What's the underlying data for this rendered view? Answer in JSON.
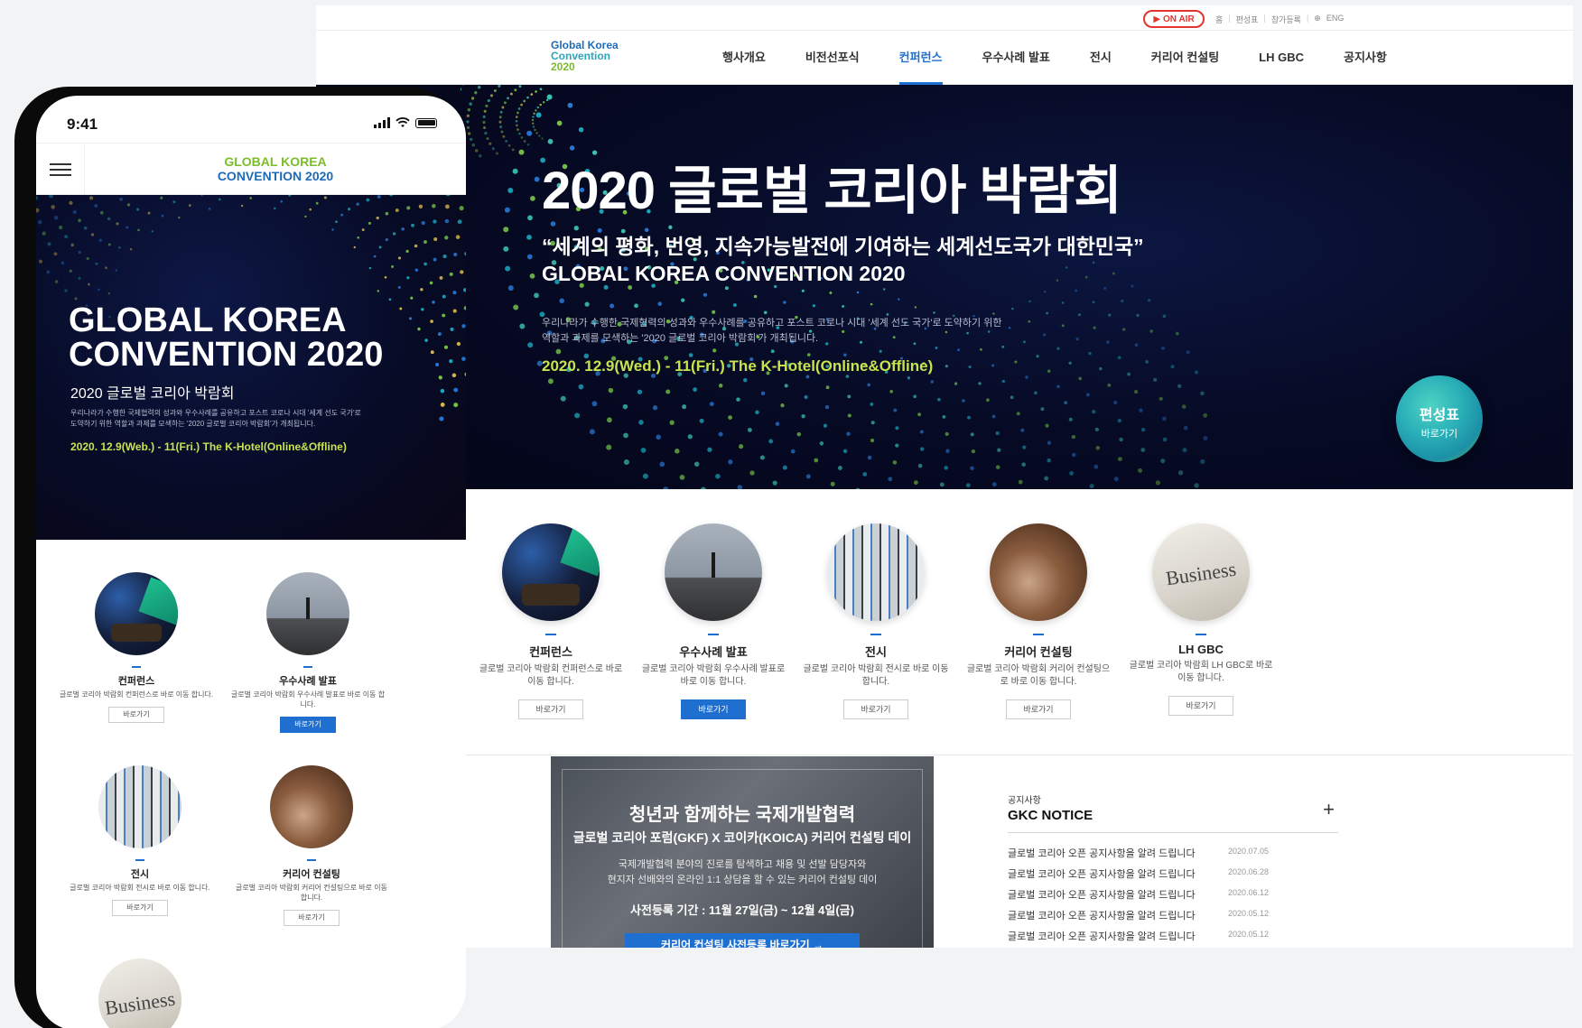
{
  "desktop": {
    "util": {
      "on_air": "ON AIR",
      "links": [
        "홈",
        "편성표",
        "참가등록",
        "ENG"
      ]
    },
    "logo": {
      "line1": "Global Korea",
      "line2": "Convention",
      "line3": "2020"
    },
    "nav": [
      "행사개요",
      "비전선포식",
      "컨퍼런스",
      "우수사례 발표",
      "전시",
      "커리어 컨설팅",
      "LH GBC",
      "공지사항"
    ],
    "nav_active": "컨퍼런스",
    "hero": {
      "title": "2020 글로벌 코리아 박람회",
      "quote": "“세계의 평화, 번영, 지속가능발전에 기여하는 세계선도국가 대한민국”",
      "subtitle_en": "GLOBAL KOREA CONVENTION 2020",
      "description": "우리나라가 수행한 국제협력의 성과와 우수사례를 공유하고 포스트 코로나 시대 '세계 선도 국가'로 도약하기 위한 역할과 과제를 모색하는 '2020 글로벌 코리아 박람회'가 개최됩니다.",
      "date": "2020. 12.9(Wed.) - 11(Fri.)  The K-Hotel(Online&Offline)",
      "badge_title": "편성표",
      "badge_sub": "바로가기"
    },
    "cards": [
      {
        "title": "컨퍼런스",
        "desc": "글로벌 코리아 박람회 컨퍼런스로 바로 이동 합니다.",
        "button": "바로가기",
        "primary": false
      },
      {
        "title": "우수사례 발표",
        "desc": "글로벌 코리아 박람회 우수사례 발표로 바로 이동 합니다.",
        "button": "바로가기",
        "primary": true
      },
      {
        "title": "전시",
        "desc": "글로벌 코리아 박람회 전시로 바로 이동 합니다.",
        "button": "바로가기",
        "primary": false
      },
      {
        "title": "커리어 컨설팅",
        "desc": "글로벌 코리아 박람회 커리어 컨설팅으로 바로 이동 합니다.",
        "button": "바로가기",
        "primary": false
      },
      {
        "title": "LH GBC",
        "desc": "글로벌 코리아 박람회 LH GBC로 바로 이동 합니다.",
        "button": "바로가기",
        "primary": false
      }
    ],
    "promo": {
      "title": "청년과 함께하는 국제개발협력",
      "subtitle": "글로벌 코리아 포럼(GKF) X 코이카(KOICA) 커리어 컨설팅 데이",
      "desc_line1": "국제개발협력 분야의 진로를 탐색하고 채용 및 선발 담당자와",
      "desc_line2": "현지자 선배와의 온라인 1:1 상담을 할 수 있는 커리어 컨설팅 데이",
      "period": "사전등록 기간 : 11월 27일(금) ~ 12월 4일(금)",
      "button": "커리어 컨설팅 사전등록 바로가기 →"
    },
    "notice": {
      "label": "공지사항",
      "title": "GKC NOTICE",
      "more": "+",
      "items": [
        {
          "title": "글로벌 코리아 오픈 공지사항을 알려 드립니다",
          "date": "2020.07.05"
        },
        {
          "title": "글로벌 코리아 오픈 공지사항을 알려 드립니다",
          "date": "2020.06.28"
        },
        {
          "title": "글로벌 코리아 오픈 공지사항을 알려 드립니다",
          "date": "2020.06.12"
        },
        {
          "title": "글로벌 코리아 오픈 공지사항을 알려 드립니다",
          "date": "2020.05.12"
        },
        {
          "title": "글로벌 코리아 오픈 공지사항을 알려 드립니다",
          "date": "2020.05.12"
        }
      ]
    }
  },
  "mobile": {
    "time": "9:41",
    "logo_line1": "GLOBAL KOREA",
    "logo_line2": "CONVENTION 2020",
    "hero": {
      "title_line1": "GLOBAL KOREA",
      "title_line2": "CONVENTION 2020",
      "subtitle": "2020 글로벌 코리아 박람회",
      "description": "우리나라가 수행한 국제협력의 성과와 우수사례를 공유하고 포스트 코로나 시대 '세계 선도 국가'로 도약하기 위한 역할과 과제를 모색하는 '2020 글로벌 코리아 박람회'가 개최됩니다.",
      "date": "2020. 12.9(Web.) - 11(Fri.)  The K-Hotel(Online&Offline)"
    },
    "cards": [
      {
        "title": "컨퍼런스",
        "desc": "글로벌 코리아 박람회 컨퍼런스로 바로 이동 합니다.",
        "button": "바로가기",
        "primary": false
      },
      {
        "title": "우수사례 발표",
        "desc": "글로벌 코리아 박람회 우수사례 발표로 바로 이동 합니다.",
        "button": "바로가기",
        "primary": true
      },
      {
        "title": "전시",
        "desc": "글로벌 코리아 박람회 전시로 바로 이동 합니다.",
        "button": "바로가기",
        "primary": false
      },
      {
        "title": "커리어 컨설팅",
        "desc": "글로벌 코리아 박람회 커리어 컨설팅으로 바로 이동 합니다.",
        "button": "바로가기",
        "primary": false
      }
    ],
    "extra_card_image": "Business"
  },
  "colors": {
    "accent": "#1f6fd1",
    "onair": "#e3342f",
    "date_highlight": "#c8e34d",
    "hero_bg": "#060a24"
  },
  "icons": [
    "play-icon",
    "globe-icon",
    "hamburger-icon",
    "signal-icon",
    "wifi-icon",
    "battery-icon",
    "plus-icon"
  ]
}
